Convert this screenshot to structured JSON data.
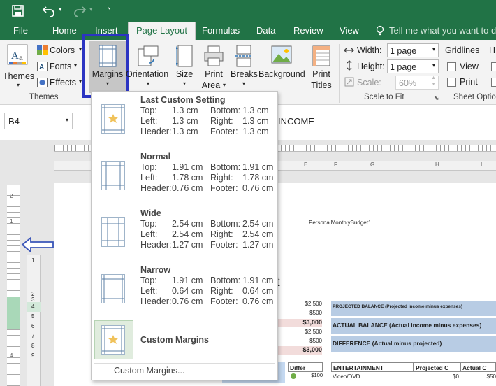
{
  "title_bar": {
    "undo_icon": "undo-icon",
    "redo_icon": "redo-icon"
  },
  "tabs": [
    "File",
    "Home",
    "Insert",
    "Page Layout",
    "Formulas",
    "Data",
    "Review",
    "View"
  ],
  "tell_me": "Tell me what you want to do...",
  "ribbon": {
    "themes": "Themes",
    "colors": "Colors",
    "fonts": "Fonts",
    "effects": "Effects",
    "margins": "Margins",
    "orientation": "Orientation",
    "size": "Size",
    "print_area": [
      "Print",
      "Area"
    ],
    "breaks": "Breaks",
    "background": "Background",
    "print_titles": [
      "Print",
      "Titles"
    ],
    "width_label": "Width:",
    "width_value": "1 page",
    "height_label": "Height:",
    "height_value": "1 page",
    "scale_label": "Scale:",
    "scale_value": "60%",
    "gridlines": "Gridlines",
    "headings_initial": "H",
    "view": "View",
    "print": "Print",
    "groups": {
      "themes": "Themes",
      "scale_to_fit": "Scale to Fit",
      "sheet_options": "Sheet Options"
    }
  },
  "name_box": "B4",
  "formula_value": "INCOME",
  "margins_menu": {
    "items": [
      {
        "name": "Last Custom Setting",
        "top": "1.3 cm",
        "bottom": "1.3 cm",
        "left": "1.3 cm",
        "right": "1.3 cm",
        "header": "1.3 cm",
        "footer": "1.3 cm"
      },
      {
        "name": "Normal",
        "top": "1.91 cm",
        "bottom": "1.91 cm",
        "left": "1.78 cm",
        "right": "1.78 cm",
        "header": "0.76 cm",
        "footer": "0.76 cm"
      },
      {
        "name": "Wide",
        "top": "2.54 cm",
        "bottom": "2.54 cm",
        "left": "2.54 cm",
        "right": "2.54 cm",
        "header": "1.27 cm",
        "footer": "1.27 cm"
      },
      {
        "name": "Narrow",
        "top": "1.91 cm",
        "bottom": "1.91 cm",
        "left": "0.64 cm",
        "right": "0.64 cm",
        "header": "0.76 cm",
        "footer": "0.76 cm"
      }
    ],
    "labels": {
      "top": "Top:",
      "bottom": "Bottom:",
      "left": "Left:",
      "right": "Right:",
      "header": "Header:",
      "footer": "Footer:"
    },
    "custom_item": "Custom Margins",
    "custom_link": "Custom Margins..."
  },
  "sheet": {
    "col_headers": [
      "E",
      "F",
      "G",
      "H",
      "I"
    ],
    "ruler_numbers": [
      "2",
      "1",
      "1",
      "2",
      "3",
      "4",
      "5",
      "6",
      "7",
      "8",
      "9",
      "2",
      "4"
    ],
    "header_text": "PersonalMonthlyBudget1",
    "title_fragment": "t",
    "amounts": [
      "$2,500",
      "$500",
      "$3,000",
      "$2,500",
      "$500",
      "$3,000"
    ],
    "projected_balance": "PROJECTED BALANCE (Projected income minus expenses)",
    "actual_balance": "ACTUAL BALANCE (Actual income minus expenses)",
    "difference": "DIFFERENCE (Actual minus projected)",
    "differ": "Differ",
    "entertainment": "ENTERTAINMENT",
    "projected_c": "Projected C",
    "actual_c": "Actual C",
    "video_dvd": "Video/DVD",
    "zero": "$0",
    "fifty": "$50",
    "hundred": "$100"
  },
  "colors": {
    "excel_green": "#217346",
    "highlight_box": "#2b34c2",
    "cell_blue": "#b8cce4",
    "cell_pink": "#f2dcdb",
    "arrow_blue": "#3a55b8"
  }
}
